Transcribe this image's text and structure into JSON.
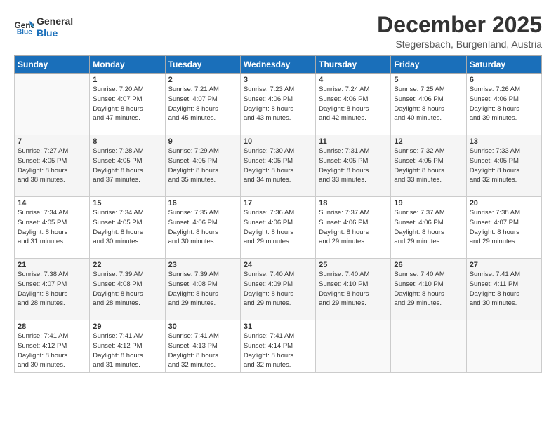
{
  "logo": {
    "line1": "General",
    "line2": "Blue"
  },
  "title": "December 2025",
  "subtitle": "Stegersbach, Burgenland, Austria",
  "days_of_week": [
    "Sunday",
    "Monday",
    "Tuesday",
    "Wednesday",
    "Thursday",
    "Friday",
    "Saturday"
  ],
  "weeks": [
    [
      {
        "day": "",
        "info": ""
      },
      {
        "day": "1",
        "info": "Sunrise: 7:20 AM\nSunset: 4:07 PM\nDaylight: 8 hours\nand 47 minutes."
      },
      {
        "day": "2",
        "info": "Sunrise: 7:21 AM\nSunset: 4:07 PM\nDaylight: 8 hours\nand 45 minutes."
      },
      {
        "day": "3",
        "info": "Sunrise: 7:23 AM\nSunset: 4:06 PM\nDaylight: 8 hours\nand 43 minutes."
      },
      {
        "day": "4",
        "info": "Sunrise: 7:24 AM\nSunset: 4:06 PM\nDaylight: 8 hours\nand 42 minutes."
      },
      {
        "day": "5",
        "info": "Sunrise: 7:25 AM\nSunset: 4:06 PM\nDaylight: 8 hours\nand 40 minutes."
      },
      {
        "day": "6",
        "info": "Sunrise: 7:26 AM\nSunset: 4:06 PM\nDaylight: 8 hours\nand 39 minutes."
      }
    ],
    [
      {
        "day": "7",
        "info": "Sunrise: 7:27 AM\nSunset: 4:05 PM\nDaylight: 8 hours\nand 38 minutes."
      },
      {
        "day": "8",
        "info": "Sunrise: 7:28 AM\nSunset: 4:05 PM\nDaylight: 8 hours\nand 37 minutes."
      },
      {
        "day": "9",
        "info": "Sunrise: 7:29 AM\nSunset: 4:05 PM\nDaylight: 8 hours\nand 35 minutes."
      },
      {
        "day": "10",
        "info": "Sunrise: 7:30 AM\nSunset: 4:05 PM\nDaylight: 8 hours\nand 34 minutes."
      },
      {
        "day": "11",
        "info": "Sunrise: 7:31 AM\nSunset: 4:05 PM\nDaylight: 8 hours\nand 33 minutes."
      },
      {
        "day": "12",
        "info": "Sunrise: 7:32 AM\nSunset: 4:05 PM\nDaylight: 8 hours\nand 33 minutes."
      },
      {
        "day": "13",
        "info": "Sunrise: 7:33 AM\nSunset: 4:05 PM\nDaylight: 8 hours\nand 32 minutes."
      }
    ],
    [
      {
        "day": "14",
        "info": "Sunrise: 7:34 AM\nSunset: 4:05 PM\nDaylight: 8 hours\nand 31 minutes."
      },
      {
        "day": "15",
        "info": "Sunrise: 7:34 AM\nSunset: 4:05 PM\nDaylight: 8 hours\nand 30 minutes."
      },
      {
        "day": "16",
        "info": "Sunrise: 7:35 AM\nSunset: 4:06 PM\nDaylight: 8 hours\nand 30 minutes."
      },
      {
        "day": "17",
        "info": "Sunrise: 7:36 AM\nSunset: 4:06 PM\nDaylight: 8 hours\nand 29 minutes."
      },
      {
        "day": "18",
        "info": "Sunrise: 7:37 AM\nSunset: 4:06 PM\nDaylight: 8 hours\nand 29 minutes."
      },
      {
        "day": "19",
        "info": "Sunrise: 7:37 AM\nSunset: 4:06 PM\nDaylight: 8 hours\nand 29 minutes."
      },
      {
        "day": "20",
        "info": "Sunrise: 7:38 AM\nSunset: 4:07 PM\nDaylight: 8 hours\nand 29 minutes."
      }
    ],
    [
      {
        "day": "21",
        "info": "Sunrise: 7:38 AM\nSunset: 4:07 PM\nDaylight: 8 hours\nand 28 minutes."
      },
      {
        "day": "22",
        "info": "Sunrise: 7:39 AM\nSunset: 4:08 PM\nDaylight: 8 hours\nand 28 minutes."
      },
      {
        "day": "23",
        "info": "Sunrise: 7:39 AM\nSunset: 4:08 PM\nDaylight: 8 hours\nand 29 minutes."
      },
      {
        "day": "24",
        "info": "Sunrise: 7:40 AM\nSunset: 4:09 PM\nDaylight: 8 hours\nand 29 minutes."
      },
      {
        "day": "25",
        "info": "Sunrise: 7:40 AM\nSunset: 4:10 PM\nDaylight: 8 hours\nand 29 minutes."
      },
      {
        "day": "26",
        "info": "Sunrise: 7:40 AM\nSunset: 4:10 PM\nDaylight: 8 hours\nand 29 minutes."
      },
      {
        "day": "27",
        "info": "Sunrise: 7:41 AM\nSunset: 4:11 PM\nDaylight: 8 hours\nand 30 minutes."
      }
    ],
    [
      {
        "day": "28",
        "info": "Sunrise: 7:41 AM\nSunset: 4:12 PM\nDaylight: 8 hours\nand 30 minutes."
      },
      {
        "day": "29",
        "info": "Sunrise: 7:41 AM\nSunset: 4:12 PM\nDaylight: 8 hours\nand 31 minutes."
      },
      {
        "day": "30",
        "info": "Sunrise: 7:41 AM\nSunset: 4:13 PM\nDaylight: 8 hours\nand 32 minutes."
      },
      {
        "day": "31",
        "info": "Sunrise: 7:41 AM\nSunset: 4:14 PM\nDaylight: 8 hours\nand 32 minutes."
      },
      {
        "day": "",
        "info": ""
      },
      {
        "day": "",
        "info": ""
      },
      {
        "day": "",
        "info": ""
      }
    ]
  ]
}
